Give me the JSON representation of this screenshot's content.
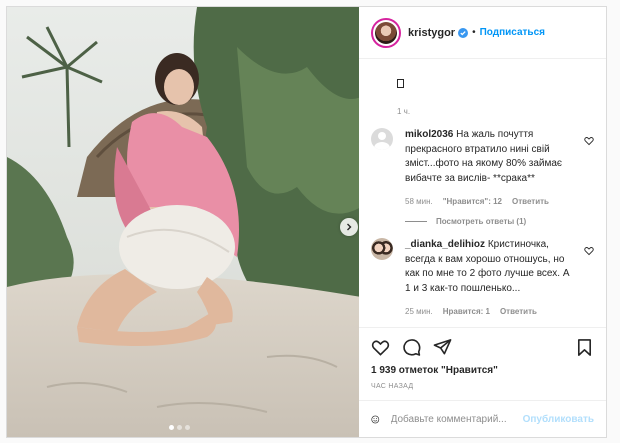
{
  "header": {
    "username": "kristygor",
    "separator": "•",
    "follow_label": "Подписаться"
  },
  "post": {
    "top_time": "1 ч.",
    "likes": "1 939 отметок \"Нравится\"",
    "ago": "ЧАС НАЗАД",
    "carousel": {
      "slides": 3,
      "active": 1
    }
  },
  "comments": [
    {
      "user": "mikol2036",
      "text": "На жаль почуття прекрасного втратило нині свій зміст...фото на якому 80% займає вибачте за вислів- **срака**",
      "time": "58 мин.",
      "likes": "\"Нравится\": 12",
      "reply": "Ответить"
    },
    {
      "user": "_dianka_delihioz",
      "text": "Кристиночка, всегда к вам хорошо отношусь, но как по мне то 2 фото лучше всех. А 1 и 3 как-то пошленько...",
      "time": "25 мин.",
      "likes": "Нравится: 1",
      "reply": "Ответить"
    }
  ],
  "view_replies": "Посмотреть ответы (1)",
  "composer": {
    "placeholder": "Добавьте комментарий...",
    "post_label": "Опубликовать"
  },
  "icons": {
    "verified": "verified-badge-icon",
    "like": "heart-icon",
    "comment": "comment-icon",
    "share": "paper-plane-icon",
    "save": "bookmark-icon",
    "emoji": "emoji-icon",
    "next": "chevron-right-icon"
  },
  "colors": {
    "accent": "#0095f6",
    "muted": "#8e8e8e",
    "post_disabled": "#b2dffc",
    "sweater": "#e98fa6"
  }
}
